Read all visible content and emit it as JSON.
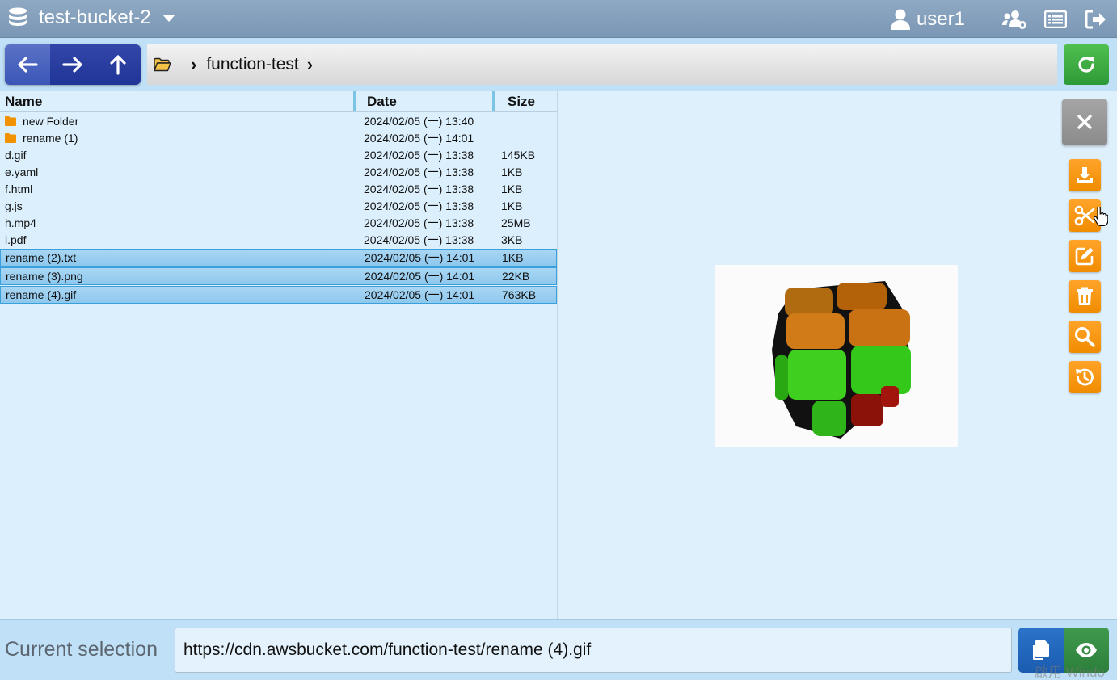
{
  "header": {
    "bucket_name": "test-bucket-2",
    "user_name": "user1",
    "icons": [
      "database-icon",
      "caret-down-icon",
      "user-icon",
      "users-gear-icon",
      "list-icon",
      "logout-icon"
    ]
  },
  "nav": {
    "breadcrumb": {
      "folder": "function-test"
    }
  },
  "file_table": {
    "columns": {
      "name": "Name",
      "date": "Date",
      "size": "Size"
    },
    "rows": [
      {
        "name": "new Folder",
        "date": "2024/02/05 (一) 13:40",
        "size": "",
        "type": "folder",
        "selected": false
      },
      {
        "name": "rename (1)",
        "date": "2024/02/05 (一) 14:01",
        "size": "",
        "type": "folder",
        "selected": false
      },
      {
        "name": "d.gif",
        "date": "2024/02/05 (一) 13:38",
        "size": "145KB",
        "type": "file",
        "selected": false
      },
      {
        "name": "e.yaml",
        "date": "2024/02/05 (一) 13:38",
        "size": "1KB",
        "type": "file",
        "selected": false
      },
      {
        "name": "f.html",
        "date": "2024/02/05 (一) 13:38",
        "size": "1KB",
        "type": "file",
        "selected": false
      },
      {
        "name": "g.js",
        "date": "2024/02/05 (一) 13:38",
        "size": "1KB",
        "type": "file",
        "selected": false
      },
      {
        "name": "h.mp4",
        "date": "2024/02/05 (一) 13:38",
        "size": "25MB",
        "type": "file",
        "selected": false
      },
      {
        "name": "i.pdf",
        "date": "2024/02/05 (一) 13:38",
        "size": "3KB",
        "type": "file",
        "selected": false
      },
      {
        "name": "rename (2).txt",
        "date": "2024/02/05 (一) 14:01",
        "size": "1KB",
        "type": "file",
        "selected": true
      },
      {
        "name": "rename (3).png",
        "date": "2024/02/05 (一) 14:01",
        "size": "22KB",
        "type": "file",
        "selected": true
      },
      {
        "name": "rename (4).gif",
        "date": "2024/02/05 (一) 14:01",
        "size": "763KB",
        "type": "file",
        "selected": true
      }
    ]
  },
  "preview": {
    "actions": [
      "download-icon",
      "cut-icon",
      "edit-icon",
      "trash-icon",
      "search-icon",
      "history-icon"
    ]
  },
  "footer": {
    "label": "Current selection",
    "url": "https://cdn.awsbucket.com/function-test/rename (4).gif",
    "watermark": "啟用 Windo"
  },
  "colors": {
    "accent_blue": "#1f3597",
    "refresh_green": "#2e9a37",
    "action_orange": "#f08c00",
    "folder_orange": "#f39200"
  }
}
